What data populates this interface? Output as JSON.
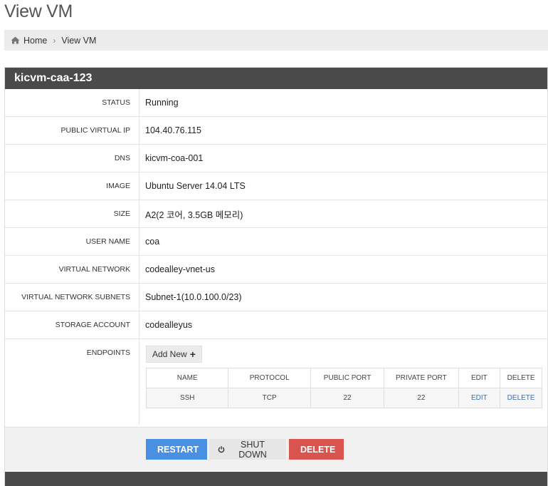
{
  "page": {
    "title": "View VM"
  },
  "breadcrumb": {
    "home": "Home",
    "separator": "›",
    "current": "View VM"
  },
  "vm": {
    "name": "kicvm-caa-123",
    "details": [
      {
        "label": "STATUS",
        "value": "Running"
      },
      {
        "label": "PUBLIC VIRTUAL IP",
        "value": "104.40.76.115"
      },
      {
        "label": "DNS",
        "value": "kicvm-coa-001"
      },
      {
        "label": "IMAGE",
        "value": "Ubuntu Server 14.04 LTS"
      },
      {
        "label": "SIZE",
        "value": "A2(2 코어, 3.5GB 메모리)"
      },
      {
        "label": "USER NAME",
        "value": "coa"
      },
      {
        "label": "VIRTUAL NETWORK",
        "value": "codealley-vnet-us"
      },
      {
        "label": "VIRTUAL NETWORK SUBNETS",
        "value": "Subnet-1(10.0.100.0/23)"
      },
      {
        "label": "STORAGE ACCOUNT",
        "value": "codealleyus"
      }
    ],
    "endpoints": {
      "label": "ENDPOINTS",
      "add_new_label": "Add New",
      "columns": [
        "NAME",
        "PROTOCOL",
        "PUBLIC PORT",
        "PRIVATE PORT",
        "EDIT",
        "DELETE"
      ],
      "rows": [
        {
          "name": "SSH",
          "protocol": "TCP",
          "public_port": "22",
          "private_port": "22",
          "edit": "EDIT",
          "delete": "DELETE"
        }
      ]
    }
  },
  "actions": {
    "restart_label": "RESTART",
    "shutdown_label": "SHUT DOWN",
    "delete_label": "DELETE"
  },
  "colors": {
    "header": "#4a4a4a",
    "restart": "#4a90e2",
    "delete": "#d9534f",
    "link": "#3a6fb0"
  },
  "icons": {
    "home": "home-icon",
    "plus": "plus-icon",
    "restart": "refresh-icon",
    "shutdown": "power-icon",
    "delete": "minus-circle-icon"
  }
}
